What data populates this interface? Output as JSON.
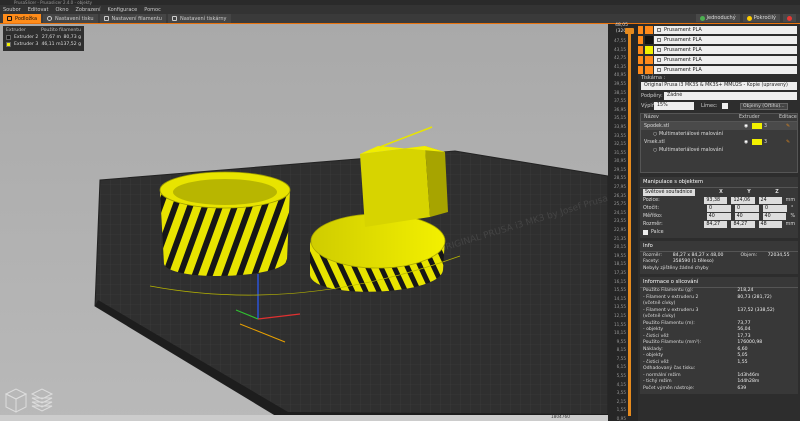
{
  "window": {
    "title": "PrusaSlicer - Prusaslicer 2.4.0 - objekty"
  },
  "menu": [
    "Soubor",
    "Editovat",
    "Okno",
    "Zobrazení",
    "Konfigurace",
    "Pomoc"
  ],
  "tabs": [
    {
      "label": "Podložka",
      "active": true
    },
    {
      "label": "Nastavení tisku",
      "active": false
    },
    {
      "label": "Nastavení filamentu",
      "active": false
    },
    {
      "label": "Nastavení tiskárny",
      "active": false
    }
  ],
  "modes": [
    {
      "label": "Jednoduchý",
      "color": "#4caf50"
    },
    {
      "label": "Pokročilý",
      "color": "#ffcc00"
    },
    {
      "label": "Expert",
      "color": "#e53935"
    }
  ],
  "legend": {
    "header_left": "Extruder",
    "header_right": "Použito filamentu",
    "rows": [
      {
        "name": "Extruder 2",
        "color": "#1a1a1a",
        "m": "27,67 m",
        "g": "80,73 g"
      },
      {
        "name": "Extruder 3",
        "color": "#f2f000",
        "m": "46,11 m",
        "g": "137,52 g"
      }
    ]
  },
  "layer_slider": {
    "top_value": "48,05",
    "top_layer": "(320)",
    "ticks": [
      "47,55",
      "43,15",
      "42,75",
      "41,35",
      "40,95",
      "39,55",
      "38,15",
      "37,55",
      "36,95",
      "35,15",
      "33,95",
      "33,55",
      "32,15",
      "31,55",
      "30,95",
      "29,15",
      "28,55",
      "27,95",
      "26,35",
      "25,75",
      "24,15",
      "23,55",
      "22,95",
      "21,35",
      "20,15",
      "19,55",
      "18,15",
      "17,35",
      "16,15",
      "15,55",
      "14,15",
      "13,55",
      "12,15",
      "11,55",
      "10,15",
      "9,55",
      "8,15",
      "7,55",
      "6,15",
      "5,55",
      "4,15",
      "3,55",
      "2,15",
      "1,55",
      "0,95"
    ]
  },
  "filaments": [
    "Prusament PLA",
    "Prusament PLA",
    "Prusament PLA",
    "Prusament PLA",
    "Prusament PLA"
  ],
  "filament_colors": [
    "#ff8a1a",
    "#111111",
    "#ff8a1a",
    "#f2f000",
    "#ff8a1a"
  ],
  "printer": {
    "label": "Tiskárna :",
    "value": "Original Prusa i3 MK3S & MK3S+ MMU2S - Kopie (upravený)"
  },
  "supports": {
    "label": "Podpěry:",
    "value": "Žádné"
  },
  "infill": {
    "label": "Výplň:",
    "value": "15%",
    "brim_label": "Límec:",
    "wizard_label": "Objemy (Ořtiho)..."
  },
  "object_list": {
    "headers": [
      "Název",
      "Extruder",
      "Editace"
    ],
    "items": [
      {
        "name": "Spodek.stl",
        "extruder": "3",
        "sub": "Multimateriálové malování"
      },
      {
        "name": "Vrsek.stl",
        "extruder": "3",
        "sub": "Multimateriálové malování"
      }
    ]
  },
  "manipulation": {
    "title": "Manipulace s objektem",
    "coord_system": "Světové souřadnice",
    "axes": [
      "X",
      "Y",
      "Z"
    ],
    "rows": [
      {
        "label": "Pozice:",
        "x": "93,38",
        "y": "124,06",
        "z": "24",
        "unit": "mm"
      },
      {
        "label": "Otočit:",
        "x": "0",
        "y": "0",
        "z": "0",
        "unit": "°"
      },
      {
        "label": "Měřítko:",
        "x": "40",
        "y": "40",
        "z": "40",
        "unit": "%"
      },
      {
        "label": "Rozměr:",
        "x": "84,27",
        "y": "84,27",
        "z": "48",
        "unit": "mm"
      }
    ],
    "inches_label": "Palce"
  },
  "info": {
    "title": "Info",
    "rows": [
      {
        "k": "Rozměr:",
        "v": "84,27 x 84,27 x 48,00",
        "k2": "Objem:",
        "v2": "72034,55"
      },
      {
        "k": "Facety:",
        "v": "358590 (1 těleso)",
        "k2": "",
        "v2": ""
      },
      {
        "k": "Nebyly zjištěny žádné chyby",
        "v": "",
        "k2": "",
        "v2": ""
      }
    ]
  },
  "slicing": {
    "title": "Informace o slicování",
    "rows": [
      {
        "k": "Použito Filamentu (g):",
        "v": "218,24"
      },
      {
        "k": "  - Filament v extruderu 2",
        "v": "80,73 (281,72)"
      },
      {
        "k": "    (včetně cívky)",
        "v": ""
      },
      {
        "k": "  - Filament v extruderu 3",
        "v": "137,52 (338,52)"
      },
      {
        "k": "    (včetně cívky)",
        "v": ""
      },
      {
        "k": "Použito Filamentu (m):",
        "v": "73,77"
      },
      {
        "k": "  - objekty",
        "v": "56,04"
      },
      {
        "k": "  - čisticí věž",
        "v": "17,73"
      },
      {
        "k": "Použito Filamentu (mm³):",
        "v": "176000,98"
      },
      {
        "k": "Náklady:",
        "v": "6,60"
      },
      {
        "k": "  - objekty",
        "v": "5,05"
      },
      {
        "k": "  - čisticí věž",
        "v": "1,55"
      },
      {
        "k": "Odhadovaný čas tisku:",
        "v": ""
      },
      {
        "k": "  - normální režim",
        "v": "1d3h46m"
      },
      {
        "k": "  - tichý režim",
        "v": "1d4h28m"
      },
      {
        "k": "Počet výměn nástroje:",
        "v": "639"
      }
    ]
  },
  "bed_label": "ORIGINAL PRUSA i3 MK3 by Josef Prusa",
  "status_value": "1804760"
}
